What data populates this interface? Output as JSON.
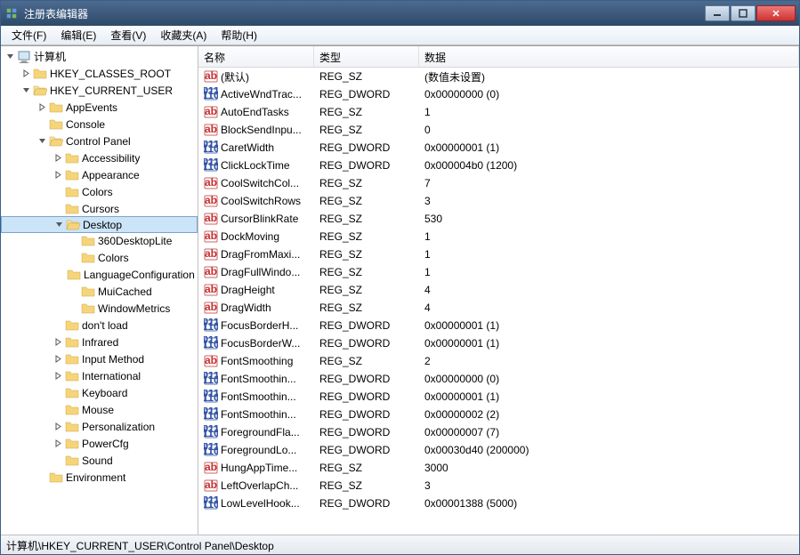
{
  "window": {
    "title": "注册表编辑器"
  },
  "menu": [
    "文件(F)",
    "编辑(E)",
    "查看(V)",
    "收藏夹(A)",
    "帮助(H)"
  ],
  "tree": {
    "root": "计算机",
    "nodes": [
      {
        "label": "HKEY_CLASSES_ROOT",
        "depth": 1,
        "expanded": false,
        "hasChildren": true
      },
      {
        "label": "HKEY_CURRENT_USER",
        "depth": 1,
        "expanded": true,
        "hasChildren": true
      },
      {
        "label": "AppEvents",
        "depth": 2,
        "expanded": false,
        "hasChildren": true
      },
      {
        "label": "Console",
        "depth": 2,
        "expanded": false,
        "hasChildren": false
      },
      {
        "label": "Control Panel",
        "depth": 2,
        "expanded": true,
        "hasChildren": true
      },
      {
        "label": "Accessibility",
        "depth": 3,
        "expanded": false,
        "hasChildren": true
      },
      {
        "label": "Appearance",
        "depth": 3,
        "expanded": false,
        "hasChildren": true
      },
      {
        "label": "Colors",
        "depth": 3,
        "expanded": false,
        "hasChildren": false
      },
      {
        "label": "Cursors",
        "depth": 3,
        "expanded": false,
        "hasChildren": false
      },
      {
        "label": "Desktop",
        "depth": 3,
        "expanded": true,
        "hasChildren": true,
        "selected": true
      },
      {
        "label": "360DesktopLite",
        "depth": 4,
        "expanded": false,
        "hasChildren": false
      },
      {
        "label": "Colors",
        "depth": 4,
        "expanded": false,
        "hasChildren": false
      },
      {
        "label": "LanguageConfiguration",
        "depth": 4,
        "expanded": false,
        "hasChildren": false
      },
      {
        "label": "MuiCached",
        "depth": 4,
        "expanded": false,
        "hasChildren": false
      },
      {
        "label": "WindowMetrics",
        "depth": 4,
        "expanded": false,
        "hasChildren": false
      },
      {
        "label": "don't load",
        "depth": 3,
        "expanded": false,
        "hasChildren": false
      },
      {
        "label": "Infrared",
        "depth": 3,
        "expanded": false,
        "hasChildren": true
      },
      {
        "label": "Input Method",
        "depth": 3,
        "expanded": false,
        "hasChildren": true
      },
      {
        "label": "International",
        "depth": 3,
        "expanded": false,
        "hasChildren": true
      },
      {
        "label": "Keyboard",
        "depth": 3,
        "expanded": false,
        "hasChildren": false
      },
      {
        "label": "Mouse",
        "depth": 3,
        "expanded": false,
        "hasChildren": false
      },
      {
        "label": "Personalization",
        "depth": 3,
        "expanded": false,
        "hasChildren": true
      },
      {
        "label": "PowerCfg",
        "depth": 3,
        "expanded": false,
        "hasChildren": true
      },
      {
        "label": "Sound",
        "depth": 3,
        "expanded": false,
        "hasChildren": false
      },
      {
        "label": "Environment",
        "depth": 2,
        "expanded": false,
        "hasChildren": false
      }
    ]
  },
  "list": {
    "headers": {
      "name": "名称",
      "type": "类型",
      "data": "数据"
    },
    "rows": [
      {
        "icon": "sz",
        "name": "(默认)",
        "type": "REG_SZ",
        "data": "(数值未设置)"
      },
      {
        "icon": "dw",
        "name": "ActiveWndTrac...",
        "type": "REG_DWORD",
        "data": "0x00000000 (0)"
      },
      {
        "icon": "sz",
        "name": "AutoEndTasks",
        "type": "REG_SZ",
        "data": "1"
      },
      {
        "icon": "sz",
        "name": "BlockSendInpu...",
        "type": "REG_SZ",
        "data": "0"
      },
      {
        "icon": "dw",
        "name": "CaretWidth",
        "type": "REG_DWORD",
        "data": "0x00000001 (1)"
      },
      {
        "icon": "dw",
        "name": "ClickLockTime",
        "type": "REG_DWORD",
        "data": "0x000004b0 (1200)"
      },
      {
        "icon": "sz",
        "name": "CoolSwitchCol...",
        "type": "REG_SZ",
        "data": "7"
      },
      {
        "icon": "sz",
        "name": "CoolSwitchRows",
        "type": "REG_SZ",
        "data": "3"
      },
      {
        "icon": "sz",
        "name": "CursorBlinkRate",
        "type": "REG_SZ",
        "data": "530"
      },
      {
        "icon": "sz",
        "name": "DockMoving",
        "type": "REG_SZ",
        "data": "1"
      },
      {
        "icon": "sz",
        "name": "DragFromMaxi...",
        "type": "REG_SZ",
        "data": "1"
      },
      {
        "icon": "sz",
        "name": "DragFullWindo...",
        "type": "REG_SZ",
        "data": "1"
      },
      {
        "icon": "sz",
        "name": "DragHeight",
        "type": "REG_SZ",
        "data": "4"
      },
      {
        "icon": "sz",
        "name": "DragWidth",
        "type": "REG_SZ",
        "data": "4"
      },
      {
        "icon": "dw",
        "name": "FocusBorderH...",
        "type": "REG_DWORD",
        "data": "0x00000001 (1)"
      },
      {
        "icon": "dw",
        "name": "FocusBorderW...",
        "type": "REG_DWORD",
        "data": "0x00000001 (1)"
      },
      {
        "icon": "sz",
        "name": "FontSmoothing",
        "type": "REG_SZ",
        "data": "2"
      },
      {
        "icon": "dw",
        "name": "FontSmoothin...",
        "type": "REG_DWORD",
        "data": "0x00000000 (0)"
      },
      {
        "icon": "dw",
        "name": "FontSmoothin...",
        "type": "REG_DWORD",
        "data": "0x00000001 (1)"
      },
      {
        "icon": "dw",
        "name": "FontSmoothin...",
        "type": "REG_DWORD",
        "data": "0x00000002 (2)"
      },
      {
        "icon": "dw",
        "name": "ForegroundFla...",
        "type": "REG_DWORD",
        "data": "0x00000007 (7)"
      },
      {
        "icon": "dw",
        "name": "ForegroundLo...",
        "type": "REG_DWORD",
        "data": "0x00030d40 (200000)"
      },
      {
        "icon": "sz",
        "name": "HungAppTime...",
        "type": "REG_SZ",
        "data": "3000"
      },
      {
        "icon": "sz",
        "name": "LeftOverlapCh...",
        "type": "REG_SZ",
        "data": "3"
      },
      {
        "icon": "dw",
        "name": "LowLevelHook...",
        "type": "REG_DWORD",
        "data": "0x00001388 (5000)"
      }
    ]
  },
  "statusbar": "计算机\\HKEY_CURRENT_USER\\Control Panel\\Desktop"
}
